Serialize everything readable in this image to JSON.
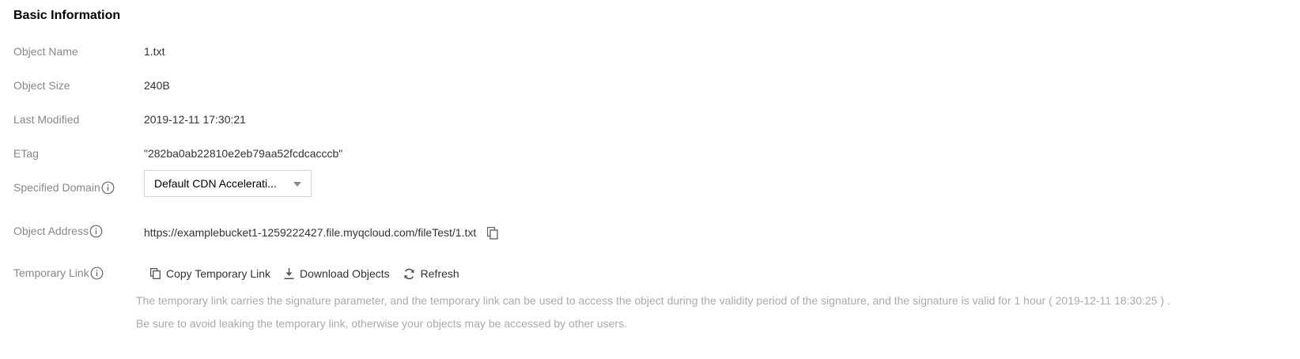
{
  "section": {
    "title": "Basic Information"
  },
  "fields": {
    "object_name": {
      "label": "Object Name",
      "value": "1.txt"
    },
    "object_size": {
      "label": "Object Size",
      "value": "240B"
    },
    "last_modified": {
      "label": "Last Modified",
      "value": "2019-12-11 17:30:21"
    },
    "etag": {
      "label": "ETag",
      "value": "\"282ba0ab22810e2eb79aa52fcdcacccb\""
    },
    "specified_domain": {
      "label": "Specified Domain",
      "selected": "Default CDN Accelerati..."
    },
    "object_address": {
      "label": "Object Address",
      "value": "https://examplebucket1-1259222427.file.myqcloud.com/fileTest/1.txt"
    },
    "temporary_link": {
      "label": "Temporary Link",
      "actions": {
        "copy": "Copy Temporary Link",
        "download": "Download Objects",
        "refresh": "Refresh"
      },
      "hint_line1": "The temporary link carries the signature parameter, and the temporary link can be used to access the object during the validity period of the signature, and the signature is valid for 1 hour ( 2019-12-11 18:30:25 ) .",
      "hint_line2": "Be sure to avoid leaking the temporary link, otherwise your objects may be accessed by other users."
    }
  },
  "icons": {
    "info": "info-icon",
    "copy": "copy-icon",
    "download": "download-icon",
    "refresh": "refresh-icon",
    "dropdown": "chevron-down-icon"
  },
  "colors": {
    "label": "#888888",
    "value": "#333333",
    "hint": "#aaaaaa",
    "border": "#cfd5de"
  }
}
